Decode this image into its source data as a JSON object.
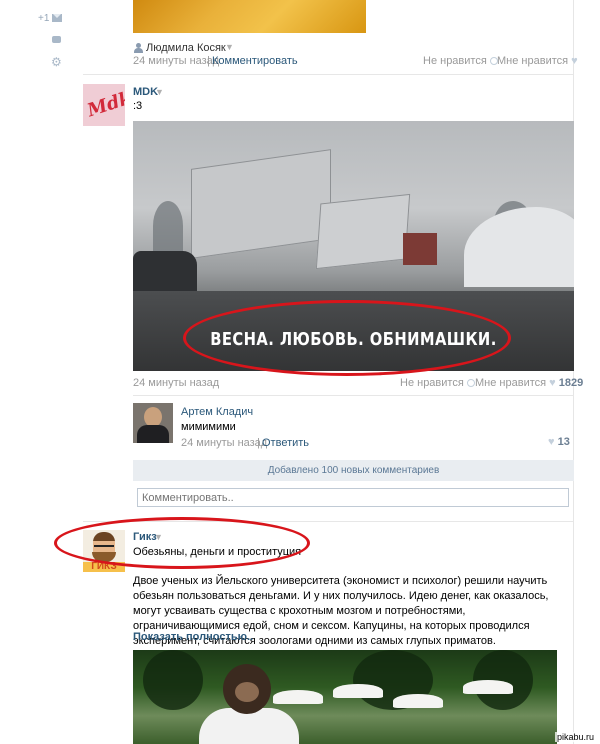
{
  "sidebar": {
    "counter": "+1"
  },
  "top_post": {
    "author": "Людмила Косяк",
    "time": "24 минуты назад",
    "separator": "|",
    "comment_link": "Комментировать",
    "dislike": "Не нравится",
    "like": "Мне нравится"
  },
  "mdk_post": {
    "author": "MDK",
    "text": ":3",
    "image_caption": "ВЕСНА. ЛЮБОВЬ. ОБНИМАШКИ.",
    "avatar_text": "Mdk",
    "time": "24 минуты назад",
    "dislike": "Не нравится",
    "like": "Мне нравится",
    "like_count": "1829"
  },
  "comment": {
    "author": "Артем Кладич",
    "text": "мимимими",
    "time": "24 минуты назад",
    "separator": "|",
    "reply_link": "Ответить",
    "like_count": "13"
  },
  "added_comments_bar": "Добавлено 100 новых комментариев",
  "comment_input": {
    "placeholder": "Комментировать.."
  },
  "gikz_post": {
    "author": "Гикз",
    "subtitle": "Обезьяны, деньги и проституция",
    "avatar_text": "ГИКЗ",
    "body": "Двое ученых из Йельского университета (экономист и психолог) решили научить обезьян пользоваться деньгами. И у них получилось. Идею денег, как оказалось, могут усваивать существа с крохотным мозгом и потребностями, ограничивающимися едой, сном и сексом. Капуцины, на которых проводился эксперимент, считаются зоологами одними из самых глупых приматов.",
    "show_more": "Показать полностью.."
  },
  "watermark": "pikabu.ru",
  "colors": {
    "link": "#2b587a",
    "annotation_red": "#d8151b",
    "bar_bg": "#e9edf1"
  }
}
